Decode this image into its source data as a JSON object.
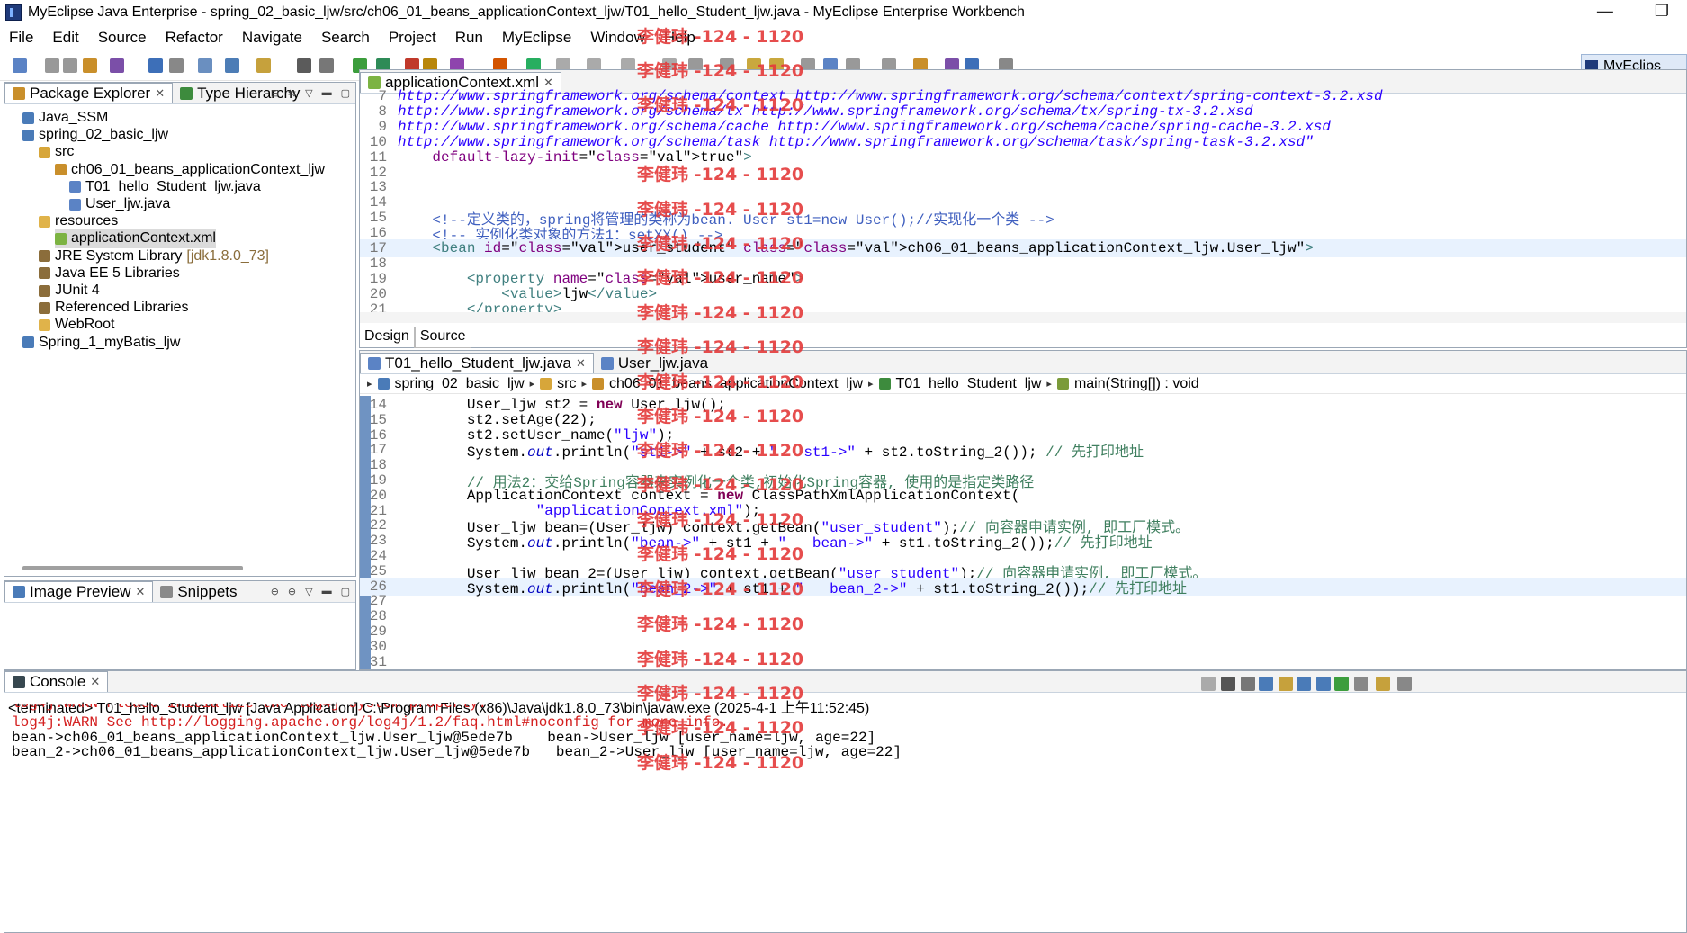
{
  "window": {
    "title": "MyEclipse Java Enterprise - spring_02_basic_ljw/src/ch06_01_beans_applicationContext_ljw/T01_hello_Student_ljw.java - MyEclipse Enterprise Workbench",
    "minimize": "—",
    "restore": "❐"
  },
  "menu": [
    "File",
    "Edit",
    "Source",
    "Refactor",
    "Navigate",
    "Search",
    "Project",
    "Run",
    "MyEclipse",
    "Window",
    "Help"
  ],
  "perspective": "MyEclips",
  "package_explorer": {
    "tabs": [
      "Package Explorer",
      "Type Hierarchy"
    ],
    "items": [
      {
        "label": "Java_SSM",
        "indent": 0,
        "icon": "project-icon"
      },
      {
        "label": "spring_02_basic_ljw",
        "indent": 0,
        "icon": "project-icon"
      },
      {
        "label": "src",
        "indent": 1,
        "icon": "source-folder-icon"
      },
      {
        "label": "ch06_01_beans_applicationContext_ljw",
        "indent": 2,
        "icon": "package-icon"
      },
      {
        "label": "T01_hello_Student_ljw.java",
        "indent": 3,
        "icon": "java-file-icon"
      },
      {
        "label": "User_ljw.java",
        "indent": 3,
        "icon": "java-file-icon"
      },
      {
        "label": "resources",
        "indent": 1,
        "icon": "folder-icon"
      },
      {
        "label": "applicationContext.xml",
        "indent": 2,
        "icon": "xml-file-icon",
        "selected": true
      },
      {
        "label": "JRE System Library",
        "suffix": "[jdk1.8.0_73]",
        "indent": 1,
        "icon": "library-icon"
      },
      {
        "label": "Java EE 5 Libraries",
        "indent": 1,
        "icon": "library-icon"
      },
      {
        "label": "JUnit 4",
        "indent": 1,
        "icon": "library-icon"
      },
      {
        "label": "Referenced Libraries",
        "indent": 1,
        "icon": "library-icon"
      },
      {
        "label": "WebRoot",
        "indent": 1,
        "icon": "folder-icon"
      },
      {
        "label": "Spring_1_myBatis_ljw",
        "indent": 0,
        "icon": "project-icon"
      }
    ]
  },
  "image_preview": {
    "tabs": [
      "Image Preview",
      "Snippets"
    ]
  },
  "xml_editor": {
    "tab": "applicationContext.xml",
    "bottom_tabs": [
      "Design",
      "Source"
    ],
    "lines": [
      {
        "n": "7",
        "text": "http://www.springframework.org/schema/context http://www.springframework.org/schema/context/spring-context-3.2.xsd"
      },
      {
        "n": "8",
        "text": "http://www.springframework.org/schema/tx http://www.springframework.org/schema/tx/spring-tx-3.2.xsd"
      },
      {
        "n": "9",
        "text": "http://www.springframework.org/schema/cache http://www.springframework.org/schema/cache/spring-cache-3.2.xsd"
      },
      {
        "n": "10",
        "text": "http://www.springframework.org/schema/task http://www.springframework.org/schema/task/spring-task-3.2.xsd\""
      },
      {
        "n": "11",
        "text": "    default-lazy-init=\"true\">"
      },
      {
        "n": "12",
        "text": ""
      },
      {
        "n": "13",
        "text": ""
      },
      {
        "n": "14",
        "text": ""
      },
      {
        "n": "15",
        "text": "    <!--定义类的，spring将管理的类称为bean. User st1=new User();//实现化一个类 -->"
      },
      {
        "n": "16",
        "text": "    <!-- 实例化类对象的方法1：setXX() -->"
      },
      {
        "n": "17",
        "text": "    <bean id=\"user_student\" class=\"ch06_01_beans_applicationContext_ljw.User_ljw\">"
      },
      {
        "n": "18",
        "text": ""
      },
      {
        "n": "19",
        "text": "        <property name=\"user_name\">"
      },
      {
        "n": "20",
        "text": "            <value>ljw</value>"
      },
      {
        "n": "21",
        "text": "        </property>"
      }
    ]
  },
  "java_editor": {
    "tabs": [
      "T01_hello_Student_ljw.java",
      "User_ljw.java"
    ],
    "breadcrumb": [
      "spring_02_basic_ljw",
      "src",
      "ch06_01_beans_applicationContext_ljw",
      "T01_hello_Student_ljw",
      "main(String[]) : void"
    ],
    "lines": [
      {
        "n": "14",
        "text": "        User_ljw st2 = new User_ljw();"
      },
      {
        "n": "15",
        "text": "        st2.setAge(22);"
      },
      {
        "n": "16",
        "text": "        st2.setUser_name(\"ljw\");"
      },
      {
        "n": "17",
        "text": "        System.out.println(\"st1->\" + st2 + \"   st1->\" + st2.toString_2()); // 先打印地址"
      },
      {
        "n": "18",
        "text": ""
      },
      {
        "n": "19",
        "text": "        // 用法2：交给Spring容器来实例化一个类,初始化Spring容器, 使用的是指定类路径"
      },
      {
        "n": "20",
        "text": "        ApplicationContext context = new ClassPathXmlApplicationContext("
      },
      {
        "n": "21",
        "text": "                \"applicationContext.xml\");"
      },
      {
        "n": "22",
        "text": "        User_ljw bean=(User_ljw) context.getBean(\"user_student\");// 向容器申请实例, 即工厂模式。"
      },
      {
        "n": "23",
        "text": "        System.out.println(\"bean->\" + st1 + \"   bean->\" + st1.toString_2());// 先打印地址"
      },
      {
        "n": "24",
        "text": ""
      },
      {
        "n": "25",
        "text": "        User_ljw bean_2=(User_ljw) context.getBean(\"user_student\");// 向容器申请实例, 即工厂模式。"
      },
      {
        "n": "26",
        "text": "        System.out.println(\"bean_2->\" + st1 + \"   bean_2->\" + st1.toString_2());// 先打印地址"
      },
      {
        "n": "27",
        "text": ""
      },
      {
        "n": "28",
        "text": ""
      },
      {
        "n": "29",
        "text": ""
      },
      {
        "n": "30",
        "text": ""
      },
      {
        "n": "31",
        "text": ""
      }
    ]
  },
  "console": {
    "tab": "Console",
    "header": "<terminated> T01_hello_Student_ljw [Java Application] C:\\Program Files (x86)\\Java\\jdk1.8.0_73\\bin\\javaw.exe (2025-4-1 上午11:52:45)",
    "lines": [
      {
        "text": "log4j:WARN Please initialize the log4j system properly.",
        "warn": true
      },
      {
        "text": "log4j:WARN See http://logging.apache.org/log4j/1.2/faq.html#noconfig for more info.",
        "warn": true
      },
      {
        "text": "bean->ch06_01_beans_applicationContext_ljw.User_ljw@5ede7b    bean->User_ljw [user_name=ljw, age=22]",
        "warn": false
      },
      {
        "text": "bean_2->ch06_01_beans_applicationContext_ljw.User_ljw@5ede7b   bean_2->User_ljw [user_name=ljw, age=22]",
        "warn": false
      }
    ]
  },
  "watermark": "李健玮 -124 - 1120"
}
